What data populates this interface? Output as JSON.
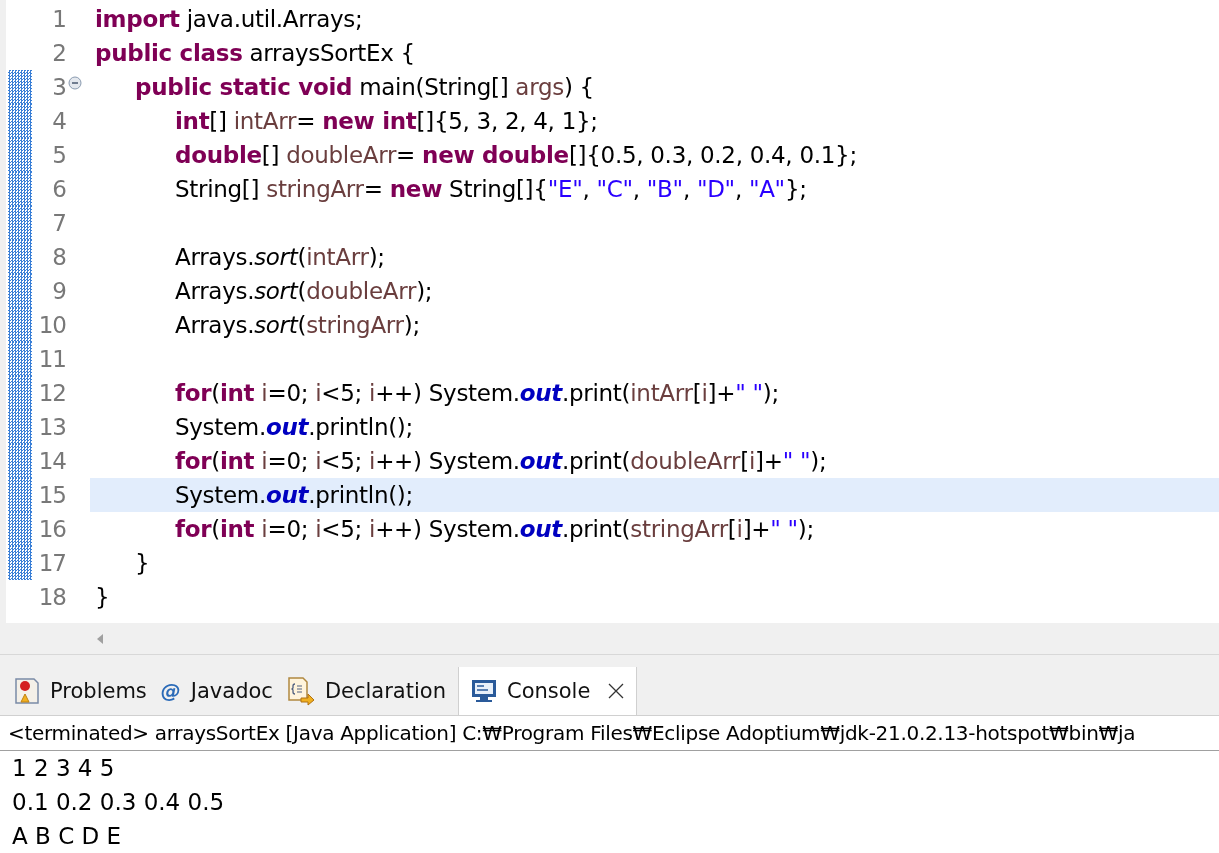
{
  "editor": {
    "lines": [
      {
        "number": "1",
        "marked": false,
        "current": false,
        "tokens": [
          {
            "kind": "keyword",
            "text": "import"
          },
          {
            "kind": "plain",
            "text": " java.util.Arrays;"
          }
        ]
      },
      {
        "number": "2",
        "marked": false,
        "current": false,
        "tokens": [
          {
            "kind": "keyword",
            "text": "public class"
          },
          {
            "kind": "plain",
            "text": " arraysSortEx {"
          }
        ]
      },
      {
        "number": "3",
        "marked": true,
        "current": false,
        "fold_expanded": true,
        "tokens": [
          {
            "kind": "keyword",
            "text": "\tpublic static void"
          },
          {
            "kind": "plain",
            "text": " main(String[] "
          },
          {
            "kind": "variable",
            "text": "args"
          },
          {
            "kind": "plain",
            "text": ") {"
          }
        ]
      },
      {
        "number": "4",
        "marked": true,
        "current": false,
        "tokens": [
          {
            "kind": "keyword",
            "text": "\t\tint"
          },
          {
            "kind": "plain",
            "text": "[] "
          },
          {
            "kind": "variable",
            "text": "intArr"
          },
          {
            "kind": "plain",
            "text": "= "
          },
          {
            "kind": "keyword",
            "text": "new int"
          },
          {
            "kind": "plain",
            "text": "[]{5, 3, 2, 4, 1};"
          }
        ]
      },
      {
        "number": "5",
        "marked": true,
        "current": false,
        "tokens": [
          {
            "kind": "keyword",
            "text": "\t\tdouble"
          },
          {
            "kind": "plain",
            "text": "[] "
          },
          {
            "kind": "variable",
            "text": "doubleArr"
          },
          {
            "kind": "plain",
            "text": "= "
          },
          {
            "kind": "keyword",
            "text": "new double"
          },
          {
            "kind": "plain",
            "text": "[]{0.5, 0.3, 0.2, 0.4, 0.1};"
          }
        ]
      },
      {
        "number": "6",
        "marked": true,
        "current": false,
        "tokens": [
          {
            "kind": "plain",
            "text": "\t\tString[] "
          },
          {
            "kind": "variable",
            "text": "stringArr"
          },
          {
            "kind": "plain",
            "text": "= "
          },
          {
            "kind": "keyword",
            "text": "new"
          },
          {
            "kind": "plain",
            "text": " String[]{"
          },
          {
            "kind": "string",
            "text": "\"E\""
          },
          {
            "kind": "plain",
            "text": ", "
          },
          {
            "kind": "string",
            "text": "\"C\""
          },
          {
            "kind": "plain",
            "text": ", "
          },
          {
            "kind": "string",
            "text": "\"B\""
          },
          {
            "kind": "plain",
            "text": ", "
          },
          {
            "kind": "string",
            "text": "\"D\""
          },
          {
            "kind": "plain",
            "text": ", "
          },
          {
            "kind": "string",
            "text": "\"A\""
          },
          {
            "kind": "plain",
            "text": "};"
          }
        ]
      },
      {
        "number": "7",
        "marked": true,
        "current": false
      },
      {
        "number": "8",
        "marked": true,
        "current": false,
        "tokens": [
          {
            "kind": "plain",
            "text": "\t\tArrays."
          },
          {
            "kind": "method",
            "text": "sort"
          },
          {
            "kind": "plain",
            "text": "("
          },
          {
            "kind": "variable",
            "text": "intArr"
          },
          {
            "kind": "plain",
            "text": ");"
          }
        ]
      },
      {
        "number": "9",
        "marked": true,
        "current": false,
        "tokens": [
          {
            "kind": "plain",
            "text": "\t\tArrays."
          },
          {
            "kind": "method",
            "text": "sort"
          },
          {
            "kind": "plain",
            "text": "("
          },
          {
            "kind": "variable",
            "text": "doubleArr"
          },
          {
            "kind": "plain",
            "text": ");"
          }
        ]
      },
      {
        "number": "10",
        "marked": true,
        "current": false,
        "tokens": [
          {
            "kind": "plain",
            "text": "\t\tArrays."
          },
          {
            "kind": "method",
            "text": "sort"
          },
          {
            "kind": "plain",
            "text": "("
          },
          {
            "kind": "variable",
            "text": "stringArr"
          },
          {
            "kind": "plain",
            "text": ");"
          }
        ]
      },
      {
        "number": "11",
        "marked": true,
        "current": false
      },
      {
        "number": "12",
        "marked": true,
        "current": false,
        "tokens": [
          {
            "kind": "keyword",
            "text": "\t\tfor"
          },
          {
            "kind": "plain",
            "text": "("
          },
          {
            "kind": "keyword",
            "text": "int"
          },
          {
            "kind": "variable",
            "text": " i"
          },
          {
            "kind": "plain",
            "text": "=0; "
          },
          {
            "kind": "variable",
            "text": "i"
          },
          {
            "kind": "plain",
            "text": "<5; "
          },
          {
            "kind": "variable",
            "text": "i"
          },
          {
            "kind": "plain",
            "text": "++) System."
          },
          {
            "kind": "field",
            "text": "out"
          },
          {
            "kind": "plain",
            "text": ".print("
          },
          {
            "kind": "variable",
            "text": "intArr"
          },
          {
            "kind": "plain",
            "text": "["
          },
          {
            "kind": "variable",
            "text": "i"
          },
          {
            "kind": "plain",
            "text": "]+"
          },
          {
            "kind": "string",
            "text": "\" \""
          },
          {
            "kind": "plain",
            "text": ");"
          }
        ]
      },
      {
        "number": "13",
        "marked": true,
        "current": false,
        "tokens": [
          {
            "kind": "plain",
            "text": "\t\tSystem."
          },
          {
            "kind": "field",
            "text": "out"
          },
          {
            "kind": "plain",
            "text": ".println();"
          }
        ]
      },
      {
        "number": "14",
        "marked": true,
        "current": false,
        "tokens": [
          {
            "kind": "keyword",
            "text": "\t\tfor"
          },
          {
            "kind": "plain",
            "text": "("
          },
          {
            "kind": "keyword",
            "text": "int"
          },
          {
            "kind": "variable",
            "text": " i"
          },
          {
            "kind": "plain",
            "text": "=0; "
          },
          {
            "kind": "variable",
            "text": "i"
          },
          {
            "kind": "plain",
            "text": "<5; "
          },
          {
            "kind": "variable",
            "text": "i"
          },
          {
            "kind": "plain",
            "text": "++) System."
          },
          {
            "kind": "field",
            "text": "out"
          },
          {
            "kind": "plain",
            "text": ".print("
          },
          {
            "kind": "variable",
            "text": "doubleArr"
          },
          {
            "kind": "plain",
            "text": "["
          },
          {
            "kind": "variable",
            "text": "i"
          },
          {
            "kind": "plain",
            "text": "]+"
          },
          {
            "kind": "string",
            "text": "\" \""
          },
          {
            "kind": "plain",
            "text": ");"
          }
        ]
      },
      {
        "number": "15",
        "marked": true,
        "current": true,
        "tokens": [
          {
            "kind": "plain",
            "text": "\t\tSystem."
          },
          {
            "kind": "field",
            "text": "out"
          },
          {
            "kind": "plain",
            "text": ".println();"
          }
        ]
      },
      {
        "number": "16",
        "marked": true,
        "current": false,
        "tokens": [
          {
            "kind": "keyword",
            "text": "\t\tfor"
          },
          {
            "kind": "plain",
            "text": "("
          },
          {
            "kind": "keyword",
            "text": "int"
          },
          {
            "kind": "variable",
            "text": " i"
          },
          {
            "kind": "plain",
            "text": "=0; "
          },
          {
            "kind": "variable",
            "text": "i"
          },
          {
            "kind": "plain",
            "text": "<5; "
          },
          {
            "kind": "variable",
            "text": "i"
          },
          {
            "kind": "plain",
            "text": "++) System."
          },
          {
            "kind": "field",
            "text": "out"
          },
          {
            "kind": "plain",
            "text": ".print("
          },
          {
            "kind": "variable",
            "text": "stringArr"
          },
          {
            "kind": "plain",
            "text": "["
          },
          {
            "kind": "variable",
            "text": "i"
          },
          {
            "kind": "plain",
            "text": "]+"
          },
          {
            "kind": "string",
            "text": "\" \""
          },
          {
            "kind": "plain",
            "text": ");"
          }
        ]
      },
      {
        "number": "17",
        "marked": true,
        "current": false,
        "tokens": [
          {
            "kind": "plain",
            "text": "\t}"
          }
        ]
      },
      {
        "number": "18",
        "marked": false,
        "current": false,
        "tokens": [
          {
            "kind": "plain",
            "text": "}"
          }
        ]
      }
    ]
  },
  "panel": {
    "tabs": [
      {
        "kind": "problems",
        "label": "Problems",
        "selected": false
      },
      {
        "kind": "javadoc",
        "glyph": "@",
        "label": "Javadoc",
        "selected": false
      },
      {
        "kind": "declaration",
        "label": "Declaration",
        "selected": false
      },
      {
        "kind": "console",
        "label": "Console",
        "selected": true,
        "closable": true
      }
    ],
    "console_header": "<terminated> arraysSortEx [Java Application] C:₩Program Files₩Eclipse Adoptium₩jdk-21.0.2.13-hotspot₩bin₩ja",
    "output": [
      "1 2 3 4 5",
      "0.1 0.2 0.3 0.4 0.5",
      "A B C D E"
    ]
  }
}
